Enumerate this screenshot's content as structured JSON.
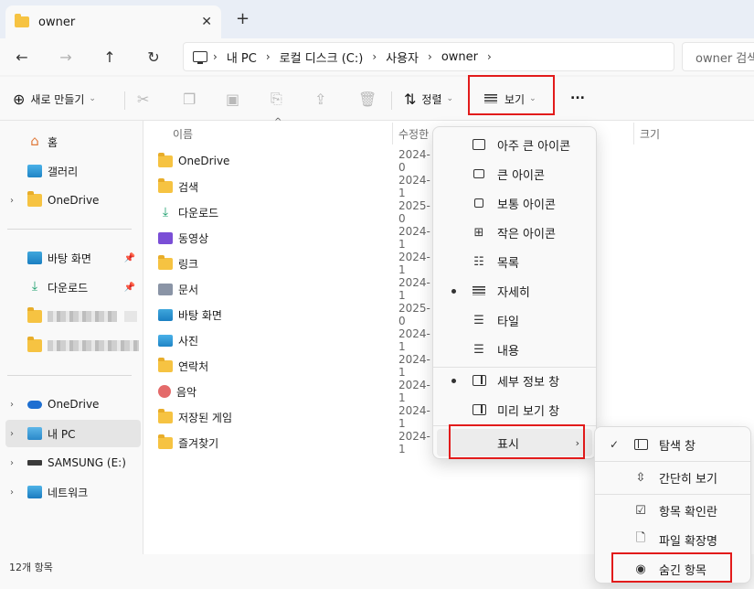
{
  "tab": {
    "title": "owner",
    "close": "✕",
    "new": "+"
  },
  "nav": {
    "back": "←",
    "forward": "→",
    "up": "↑",
    "refresh": "↻",
    "breadcrumb": [
      "내 PC",
      "로컬 디스크 (C:)",
      "사용자",
      "owner"
    ],
    "search_placeholder": "owner 검색"
  },
  "toolbar": {
    "new_label": "새로 만들기",
    "sort_label": "정렬",
    "view_label": "보기",
    "more_label": "..."
  },
  "sidebar": {
    "items": [
      {
        "label": "홈"
      },
      {
        "label": "갤러리"
      },
      {
        "label": "OneDrive"
      },
      {
        "label": "바탕 화면"
      },
      {
        "label": "다운로드"
      },
      {
        "label": "OneDrive"
      },
      {
        "label": "내 PC"
      },
      {
        "label": "SAMSUNG (E:)"
      },
      {
        "label": "네트워크"
      }
    ]
  },
  "columns": {
    "name": "이름",
    "modified": "수정한",
    "size": "크기"
  },
  "files": [
    {
      "name": "OneDrive",
      "date": "2024-0"
    },
    {
      "name": "검색",
      "date": "2024-1"
    },
    {
      "name": "다운로드",
      "date": "2025-0"
    },
    {
      "name": "동영상",
      "date": "2024-1"
    },
    {
      "name": "링크",
      "date": "2024-1"
    },
    {
      "name": "문서",
      "date": "2024-1"
    },
    {
      "name": "바탕 화면",
      "date": "2025-0"
    },
    {
      "name": "사진",
      "date": "2024-1"
    },
    {
      "name": "연락처",
      "date": "2024-1"
    },
    {
      "name": "음악",
      "date": "2024-1"
    },
    {
      "name": "저장된 게임",
      "date": "2024-1"
    },
    {
      "name": "즐겨찾기",
      "date": "2024-1"
    }
  ],
  "view_menu": {
    "items": [
      {
        "label": "아주 큰 아이콘"
      },
      {
        "label": "큰 아이콘"
      },
      {
        "label": "보통 아이콘"
      },
      {
        "label": "작은 아이콘"
      },
      {
        "label": "목록"
      },
      {
        "label": "자세히"
      },
      {
        "label": "타일"
      },
      {
        "label": "내용"
      },
      {
        "label": "세부 정보 창"
      },
      {
        "label": "미리 보기 창"
      },
      {
        "label": "표시"
      }
    ]
  },
  "show_menu": {
    "items": [
      {
        "label": "탐색 창"
      },
      {
        "label": "간단히 보기"
      },
      {
        "label": "항목 확인란"
      },
      {
        "label": "파일 확장명"
      },
      {
        "label": "숨긴 항목"
      }
    ]
  },
  "status": {
    "count": "12개 항목"
  },
  "colors": {
    "highlight": "#e21b1b",
    "folder": "#f6c342"
  }
}
